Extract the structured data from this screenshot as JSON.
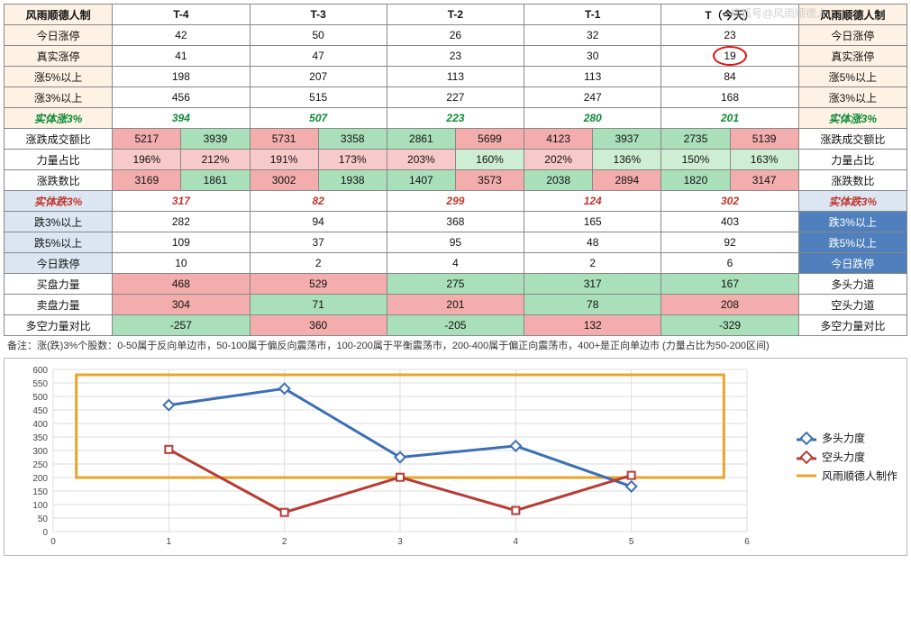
{
  "watermark": "搜狐号@风雨顺德人",
  "headers": {
    "left": "风雨顺德人制",
    "t4": "T-4",
    "t3": "T-3",
    "t2": "T-2",
    "t1": "T-1",
    "t0": "T（今天）",
    "right": "风雨顺德人制"
  },
  "rows": {
    "r0": {
      "l": "今日涨停",
      "v": [
        "42",
        "50",
        "26",
        "32",
        "23"
      ],
      "r": "今日涨停"
    },
    "r1": {
      "l": "真实涨停",
      "v": [
        "41",
        "47",
        "23",
        "30",
        "19"
      ],
      "r": "真实涨停"
    },
    "r2": {
      "l": "涨5%以上",
      "v": [
        "198",
        "207",
        "113",
        "113",
        "84"
      ],
      "r": "涨5%以上"
    },
    "r3": {
      "l": "涨3%以上",
      "v": [
        "456",
        "515",
        "227",
        "247",
        "168"
      ],
      "r": "涨3%以上"
    },
    "r4": {
      "l": "实体涨3%",
      "v": [
        "394",
        "507",
        "223",
        "280",
        "201"
      ],
      "r": "实体涨3%"
    },
    "r5": {
      "l": "涨跌成交额比",
      "v": [
        [
          "5217",
          "3939"
        ],
        [
          "5731",
          "3358"
        ],
        [
          "2861",
          "5699"
        ],
        [
          "4123",
          "3937"
        ],
        [
          "2735",
          "5139"
        ]
      ],
      "r": "涨跌成交额比",
      "cls": [
        [
          "red",
          "green"
        ],
        [
          "red",
          "green"
        ],
        [
          "green",
          "red"
        ],
        [
          "red",
          "green"
        ],
        [
          "green",
          "red"
        ]
      ]
    },
    "r6": {
      "l": "力量占比",
      "v": [
        [
          "196%",
          "212%"
        ],
        [
          "191%",
          "173%"
        ],
        [
          "203%",
          "160%"
        ],
        [
          "202%",
          "136%"
        ],
        [
          "150%",
          "163%"
        ]
      ],
      "r": "力量占比",
      "cls": [
        [
          "pred",
          "pred"
        ],
        [
          "pred",
          "pred"
        ],
        [
          "pred",
          "pgreen"
        ],
        [
          "pred",
          "pgreen"
        ],
        [
          "pgreen",
          "pgreen"
        ]
      ]
    },
    "r7": {
      "l": "涨跌数比",
      "v": [
        [
          "3169",
          "1861"
        ],
        [
          "3002",
          "1938"
        ],
        [
          "1407",
          "3573"
        ],
        [
          "2038",
          "2894"
        ],
        [
          "1820",
          "3147"
        ]
      ],
      "r": "涨跌数比",
      "cls": [
        [
          "red",
          "green"
        ],
        [
          "red",
          "green"
        ],
        [
          "green",
          "red"
        ],
        [
          "green",
          "red"
        ],
        [
          "green",
          "red"
        ]
      ]
    },
    "r8": {
      "l": "实体跌3%",
      "v": [
        "317",
        "82",
        "299",
        "124",
        "302"
      ],
      "r": "实体跌3%"
    },
    "r9": {
      "l": "跌3%以上",
      "v": [
        "282",
        "94",
        "368",
        "165",
        "403"
      ],
      "r": "跌3%以上"
    },
    "r10": {
      "l": "跌5%以上",
      "v": [
        "109",
        "37",
        "95",
        "48",
        "92"
      ],
      "r": "跌5%以上"
    },
    "r11": {
      "l": "今日跌停",
      "v": [
        "10",
        "2",
        "4",
        "2",
        "6"
      ],
      "r": "今日跌停"
    },
    "r12": {
      "l": "买盘力量",
      "v": [
        "468",
        "529",
        "275",
        "317",
        "167"
      ],
      "r": "多头力道",
      "cls": [
        "red",
        "red",
        "green",
        "green",
        "green"
      ]
    },
    "r13": {
      "l": "卖盘力量",
      "v": [
        "304",
        "71",
        "201",
        "78",
        "208"
      ],
      "r": "空头力道",
      "cls": [
        "red",
        "green",
        "red",
        "green",
        "red"
      ]
    },
    "r14": {
      "l": "多空力量对比",
      "v": [
        "-257",
        "360",
        "-205",
        "132",
        "-329"
      ],
      "r": "多空力量对比",
      "cls": [
        "green",
        "red",
        "green",
        "red",
        "green"
      ]
    }
  },
  "note": "备注：涨(跌)3%个股数：0-50属于反向单边市，50-100属于偏反向震荡市，100-200属于平衡震荡市，200-400属于偏正向震荡市，400+是正向单边市 (力量占比为50-200区间)",
  "chart_data": {
    "type": "line",
    "x": [
      1,
      2,
      3,
      4,
      5
    ],
    "series": [
      {
        "name": "多头力度",
        "values": [
          468,
          529,
          275,
          317,
          167
        ],
        "color": "#3b6fb5",
        "marker": "diamond"
      },
      {
        "name": "空头力度",
        "values": [
          304,
          71,
          201,
          78,
          208
        ],
        "color": "#b73c36",
        "marker": "square"
      },
      {
        "name": "风雨顺德人制作",
        "values": [
          200,
          200,
          200,
          200,
          200
        ],
        "color": "#e9a52a",
        "marker": "none",
        "box": true
      }
    ],
    "xlim": [
      0,
      6
    ],
    "ylim": [
      0,
      600
    ],
    "yticks": [
      0,
      50,
      100,
      150,
      200,
      250,
      300,
      350,
      400,
      450,
      500,
      550,
      600
    ],
    "xticks": [
      0,
      1,
      2,
      3,
      4,
      5,
      6
    ]
  },
  "legend": {
    "a": "多头力度",
    "b": "空头力度",
    "c": "风雨顺德人制作"
  }
}
